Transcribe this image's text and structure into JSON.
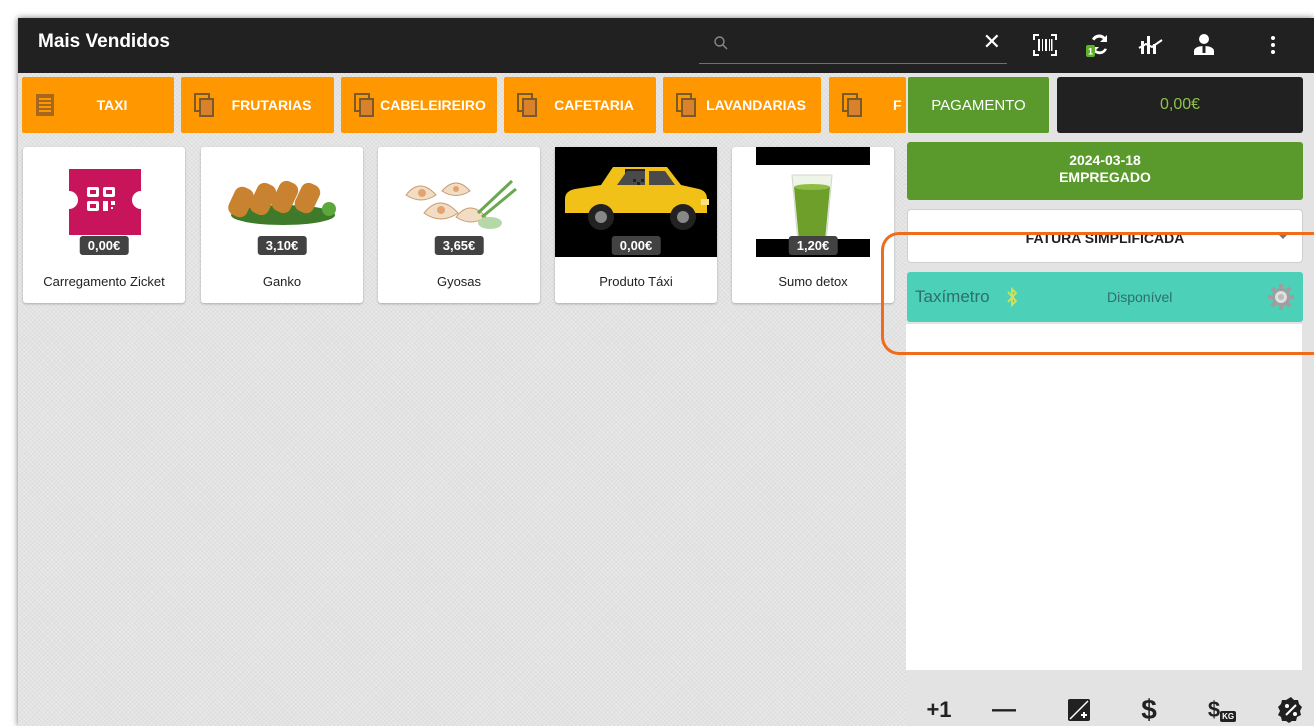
{
  "topbar": {
    "title": "Mais Vendidos",
    "search_placeholder": "",
    "clear_label": "✕",
    "sync_badge": "1"
  },
  "categories": [
    {
      "label": "TAXI",
      "icon": "list-icon"
    },
    {
      "label": "FRUTARIAS",
      "icon": "copy-icon"
    },
    {
      "label": "CABELEIREIRO",
      "icon": "copy-icon"
    },
    {
      "label": "CAFETARIA",
      "icon": "copy-icon"
    },
    {
      "label": "LAVANDARIAS",
      "icon": "copy-icon"
    },
    {
      "label": "F",
      "icon": "copy-icon"
    }
  ],
  "products": [
    {
      "name": "Carregamento Zicket",
      "price": "0,00€",
      "image": "qr-ticket"
    },
    {
      "name": "Ganko",
      "price": "3,10€",
      "image": "spring-rolls"
    },
    {
      "name": "Gyosas",
      "price": "3,65€",
      "image": "dumplings"
    },
    {
      "name": "Produto Táxi",
      "price": "0,00€",
      "image": "taxi-car"
    },
    {
      "name": "Sumo detox",
      "price": "1,20€",
      "image": "green-juice"
    }
  ],
  "panel": {
    "payment_label": "PAGAMENTO",
    "total": "0,00€",
    "date": "2024-03-18",
    "employee": "EMPREGADO",
    "document_type": "FATURA SIMPLIFICADA",
    "taximeter_label": "Taxímetro",
    "taximeter_status": "Disponível"
  },
  "bottom_toolbar": {
    "plus_one": "+1",
    "minus": "—",
    "dollar": "$",
    "dollar_kg_sub": "KG"
  },
  "colors": {
    "topbar": "#212121",
    "category_tab": "#ff9800",
    "payment": "#5a9a2c",
    "taximeter": "#4dd0b8",
    "highlight": "#ef6c1a"
  }
}
